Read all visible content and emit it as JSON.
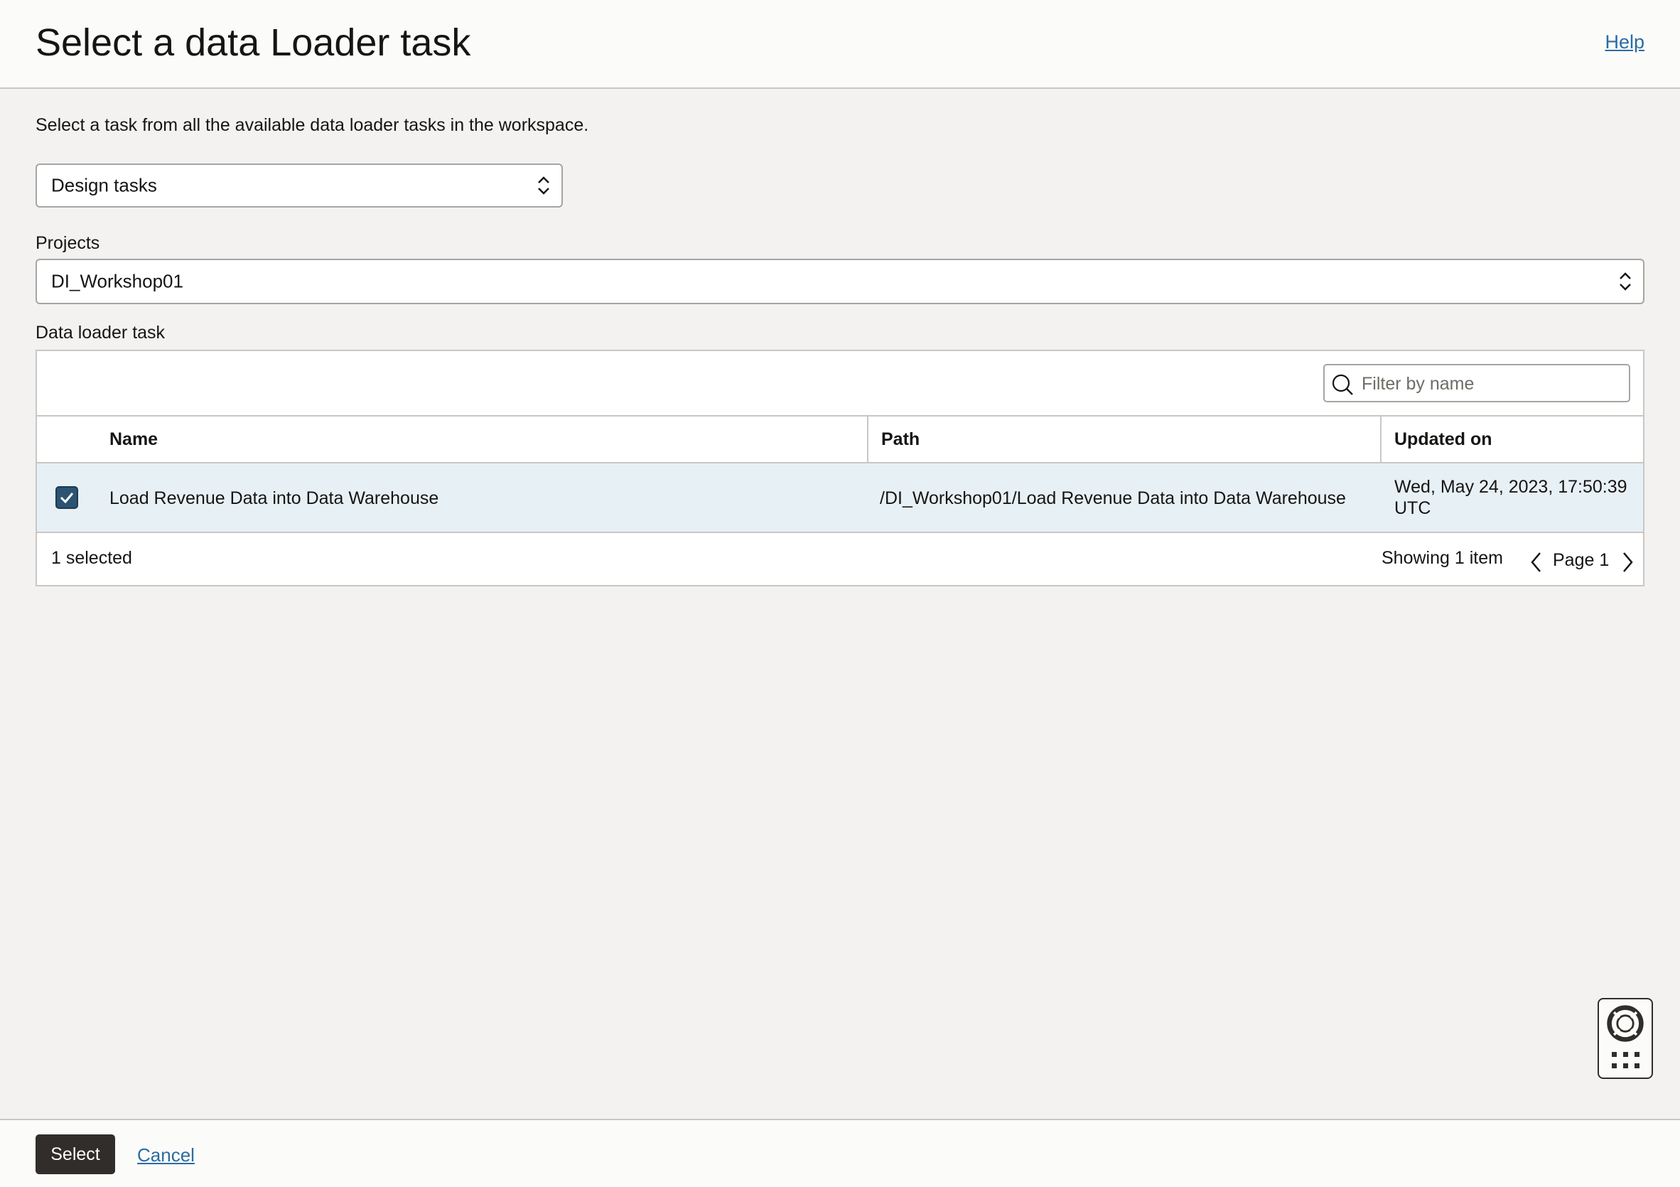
{
  "header": {
    "title": "Select a data Loader task",
    "help_label": "Help"
  },
  "intro_text": "Select a task from all the available data loader tasks in the workspace.",
  "task_type_select": {
    "value": "Design tasks"
  },
  "projects": {
    "label": "Projects",
    "value": "DI_Workshop01"
  },
  "data_loader": {
    "label": "Data loader task",
    "filter_placeholder": "Filter by name",
    "columns": [
      "Name",
      "Path",
      "Updated on"
    ],
    "rows": [
      {
        "selected": true,
        "name": "Load Revenue Data into Data Warehouse",
        "path": "/DI_Workshop01/Load Revenue Data into Data Warehouse",
        "updated_line1": "Wed, May 24, 2023, 17:50:39",
        "updated_line2": "UTC"
      }
    ],
    "footer": {
      "selected_count": "1 selected",
      "showing": "Showing 1 item",
      "page": "Page 1"
    }
  },
  "actions": {
    "select_label": "Select",
    "cancel_label": "Cancel"
  },
  "colors": {
    "accent_link": "#2b6ca3",
    "selected_row": "#e7f0f5",
    "checkbox": "#2c5372",
    "primary_button": "#312d2a"
  },
  "icons": [
    "updown-chevron-icon",
    "search-icon",
    "checkmark-icon",
    "chevron-left-icon",
    "chevron-right-icon",
    "lifebuoy-icon",
    "grid-dots-icon"
  ]
}
